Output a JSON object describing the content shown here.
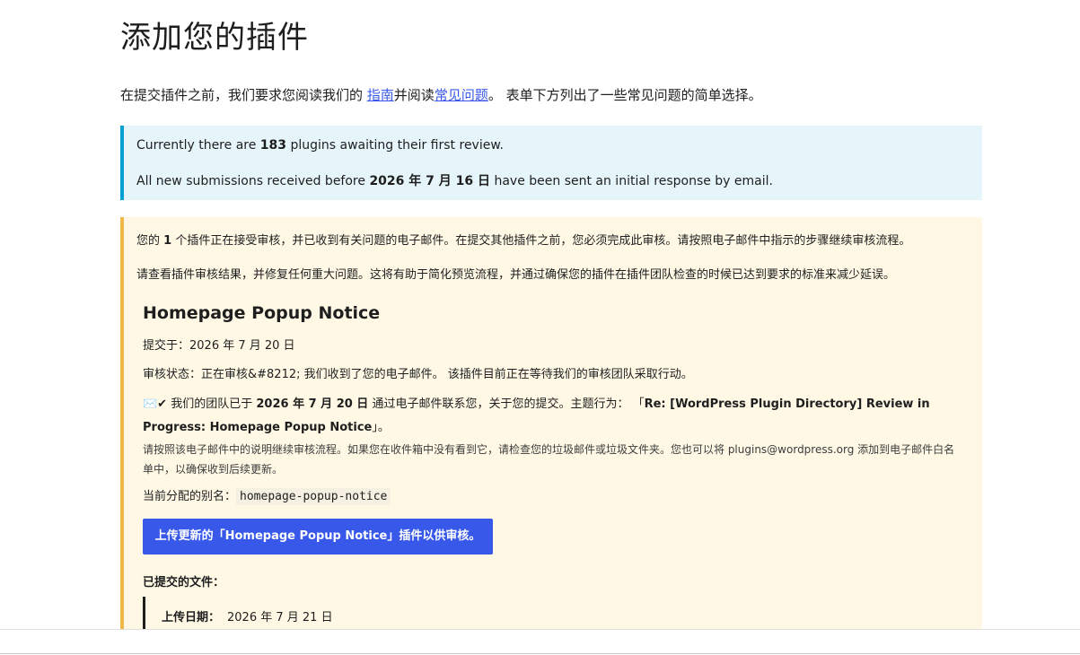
{
  "title": "添加您的插件",
  "intro": {
    "prefix": "在提交插件之前，我们要求您阅读我们的 ",
    "guide_link": "指南",
    "middle": "并阅读",
    "faq_link": "常见问题",
    "suffix": "。 表单下方列出了一些常见问题的简单选择。"
  },
  "info": {
    "line1_prefix": "Currently there are ",
    "line1_count": "183",
    "line1_suffix": " plugins awaiting their first review.",
    "line2_prefix": "All new submissions received before ",
    "line2_date": "2026 年 7 月 16 日",
    "line2_suffix": " have been sent an initial response by email."
  },
  "notice": {
    "line1_prefix": "您的 ",
    "line1_count": "1",
    "line1_suffix": " 个插件正在接受审核，并已收到有关问题的电子邮件。在提交其他插件之前，您必须完成此审核。请按照电子邮件中指示的步骤继续审核流程。",
    "line2": "请查看插件审核结果，并修复任何重大问题。这将有助于简化预览流程，并通过确保您的插件在插件团队检查的时候已达到要求的标准来减少延误。"
  },
  "plugin": {
    "name": "Homepage Popup Notice",
    "submitted": "提交于：2026 年 7 月 20 日",
    "status": "审核状态：正在审核&#8212; 我们收到了您的电子邮件。 该插件目前正在等待我们的审核团队采取行动。",
    "mail_icons": "✉️✔",
    "mail_prefix": " 我们的团队已于 ",
    "mail_date": "2026 年 7 月 20 日",
    "mail_middle": " 通过电子邮件联系您，关于您的提交。主题行为： 「",
    "mail_subject": "Re: [WordPress Plugin Directory] Review in Progress: Homepage Popup Notice",
    "mail_suffix": "」。",
    "small_note": "请按照该电子邮件中的说明继续审核流程。如果您在收件箱中没有看到它，请检查您的垃圾邮件或垃圾文件夹。您也可以将 plugins@wordpress.org 添加到电子邮件白名单中，以确保收到后续更新。",
    "slug_label": "当前分配的别名：",
    "slug": "homepage-popup-notice",
    "upload_button": "上传更新的「Homepage Popup Notice」插件以供审核。",
    "files_label": "已提交的文件：",
    "upload_date_label": "上传日期：",
    "upload_date": "2026 年 7 月 21 日"
  },
  "colors": {
    "accent": "#3858e9",
    "info_border": "#00a0d2",
    "info_bg": "#e5f5fa",
    "warn_border": "#f0b849",
    "warn_bg": "#fef8e5"
  }
}
